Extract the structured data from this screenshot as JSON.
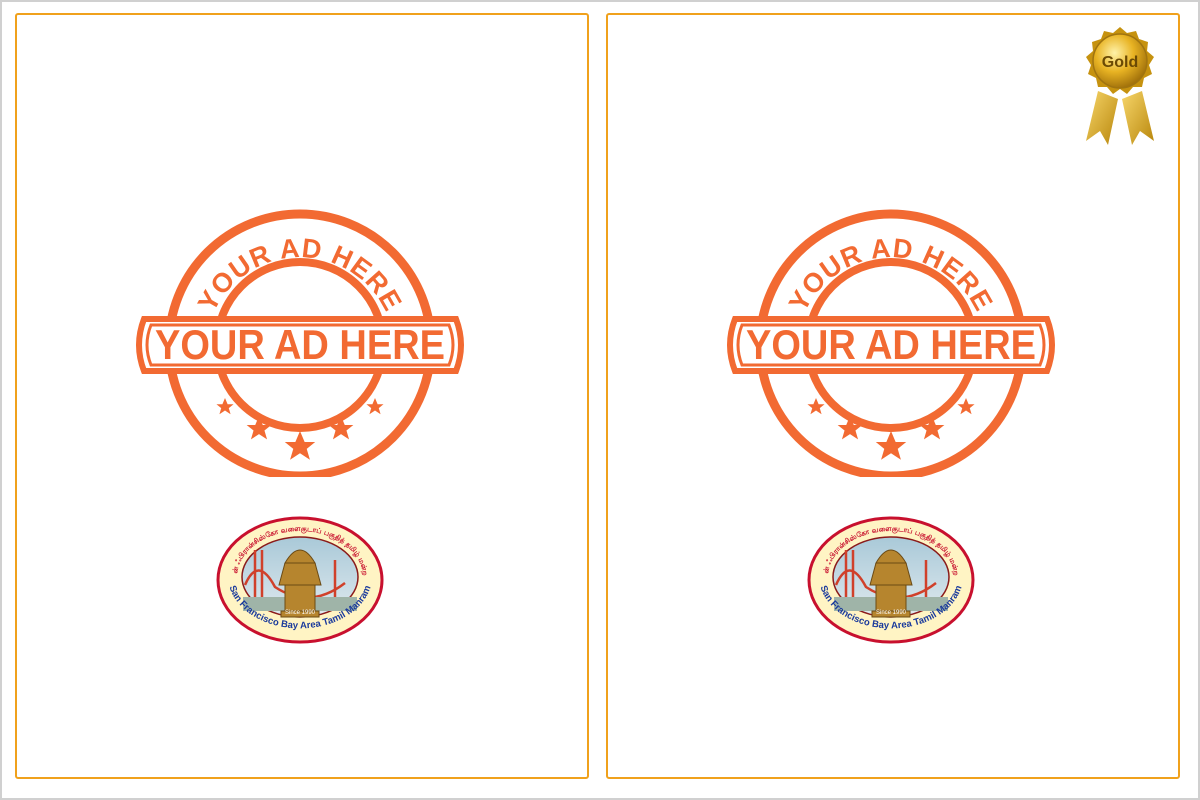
{
  "colors": {
    "panel_border": "#f0a11c",
    "outer_border": "#d0d0d0",
    "stamp": "#f26a32",
    "gold": "#e8b323"
  },
  "panels": [
    {
      "stamp_arc_text": "YOUR AD HERE",
      "stamp_band_text": "YOUR AD HERE",
      "logo": {
        "top_text": "சான் ஃபிரான்சிஸ்கோ வளைகுடாப் பகுதித் தமிழ் மன்றம்",
        "bottom_text": "San Francisco Bay Area Tamil Manram",
        "since": "Since 1990"
      }
    },
    {
      "stamp_arc_text": "YOUR AD HERE",
      "stamp_band_text": "YOUR AD HERE",
      "logo": {
        "top_text": "சான் ஃபிரான்சிஸ்கோ வளைகுடாப் பகுதித் தமிழ் மன்றம்",
        "bottom_text": "San Francisco Bay Area Tamil Manram",
        "since": "Since 1990"
      },
      "badge_label": "Gold"
    }
  ]
}
